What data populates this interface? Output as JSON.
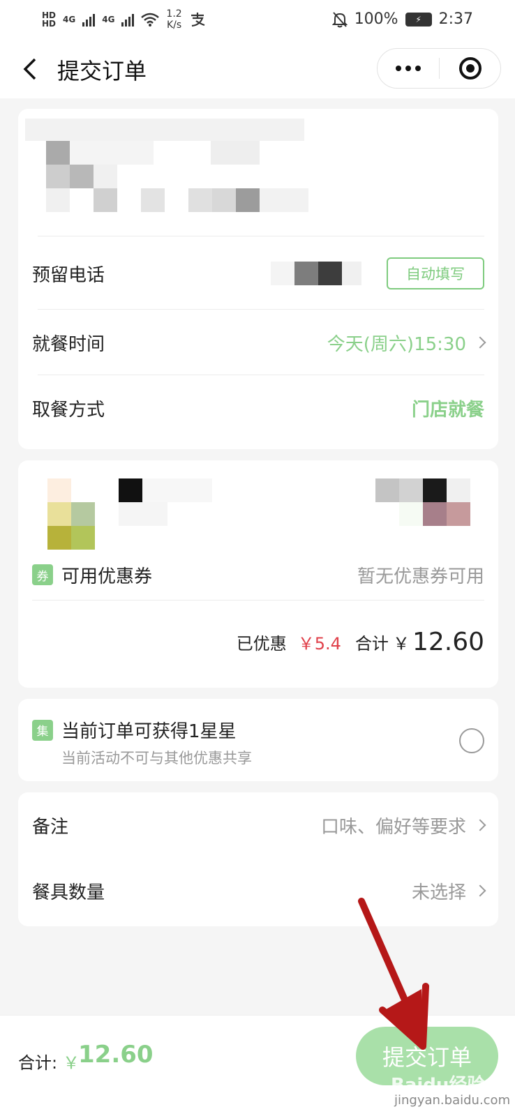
{
  "status_bar": {
    "hd1": "HD",
    "hd2": "HD",
    "net1": "4G",
    "net2": "4G",
    "speed_value": "1.2",
    "speed_unit": "K/s",
    "battery_percent": "100%",
    "time": "2:37"
  },
  "header": {
    "title": "提交订单"
  },
  "contact": {
    "phone_label": "预留电话",
    "auto_fill_label": "自动填写",
    "dining_time_label": "就餐时间",
    "dining_time_value": "今天(周六)15:30",
    "pickup_label": "取餐方式",
    "pickup_value": "门店就餐"
  },
  "order": {
    "coupon_tag": "券",
    "coupon_label": "可用优惠券",
    "coupon_value": "暂无优惠券可用",
    "discount_label": "已优惠",
    "discount_value": "￥5.4",
    "total_label": "合计",
    "total_currency": "￥",
    "total_value": "12.60"
  },
  "stars": {
    "tag": "集",
    "title": "当前订单可获得1星星",
    "subtitle": "当前活动不可与其他优惠共享"
  },
  "extras": {
    "note_label": "备注",
    "note_placeholder": "口味、偏好等要求",
    "utensils_label": "餐具数量",
    "utensils_value": "未选择"
  },
  "bottom_bar": {
    "total_label": "合计:",
    "currency": "￥",
    "amount": "12.60",
    "submit_label": "提交订单"
  },
  "watermark": {
    "text": "Baidu经验",
    "url": "jingyan.baidu.com"
  },
  "colors": {
    "accent": "#8ad08a",
    "discount": "#e0404a",
    "arrow": "#b51818"
  }
}
